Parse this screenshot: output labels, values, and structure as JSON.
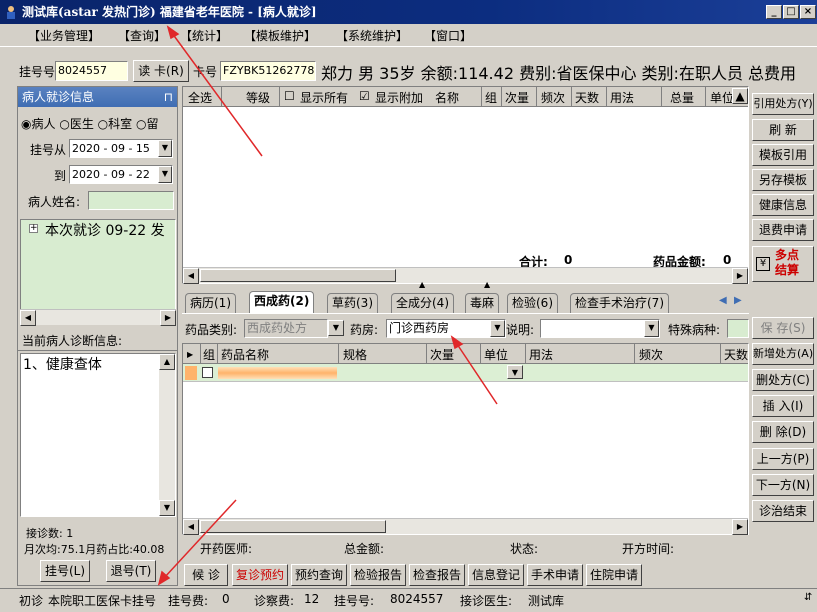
{
  "window": {
    "title": "测试库(astar 发热门诊) 福建省老年医院 - [病人就诊]",
    "min": "_",
    "max": "□",
    "close": "×"
  },
  "menu": [
    "【业务管理】",
    "【查询】",
    "【统计】",
    "【模板维护】",
    "【系统维护】",
    "【窗口】"
  ],
  "info": {
    "reg_label": "挂号号",
    "reg_no": "8024557",
    "read_card": "读 卡(R)",
    "card_label": "卡号",
    "card_no": "FZYBK51262778",
    "patient_line": "郑力  男  35岁  余额:114.42  费别:省医保中心  类别:在职人员  总费用"
  },
  "left": {
    "header": "病人就诊信息",
    "radio_patient": "病人",
    "radio_doctor": "医生",
    "radio_dept": "科室",
    "radio_stay": "留",
    "reg_from_label": "挂号从",
    "date_from": "2020 - 09 - 15",
    "to_label": "到",
    "date_to": "2020 - 09 - 22",
    "name_label": "病人姓名:",
    "tree_item": "本次就诊  09-22 发",
    "diag_header": "当前病人诊断信息:",
    "diag_item": "1、健康查体",
    "visit_count": "接诊数: 1",
    "avg": "月次均:75.1月药占比:40.08",
    "reg_btn": "挂号(L)",
    "unreg_btn": "退号(T)"
  },
  "top_grid": {
    "headers": [
      "全选",
      "等级",
      "显示所有",
      "显示附加",
      "名称",
      "组",
      "次量",
      "频次",
      "天数",
      "用法",
      "总量",
      "单位"
    ],
    "total_label": "合计:",
    "total_val": "0",
    "amount_label": "药品金额:",
    "amount_val": "0"
  },
  "tabs": [
    "病历(1)",
    "西成药(2)",
    "草药(3)",
    "全成分(4)",
    "毒麻",
    "检验(6)",
    "检查手术治疗(7)"
  ],
  "drug_form": {
    "category_label": "药品类别:",
    "category": "西成药处方",
    "pharmacy_label": "药房:",
    "pharmacy": "门诊西药房",
    "note_label": "说明:",
    "note": "",
    "special_label": "特殊病种:"
  },
  "bottom_grid": {
    "headers": [
      "组",
      "药品名称",
      "规格",
      "次量",
      "单位",
      "用法",
      "频次",
      "天数"
    ]
  },
  "presc_footer": {
    "doctor": "开药医师:",
    "total": "总金额:",
    "status": "状态:",
    "time": "开方时间:"
  },
  "bottom_buttons": [
    "候 诊",
    "复诊预约",
    "预约查询",
    "检验报告",
    "检查报告",
    "信息登记",
    "手术申请",
    "住院申请"
  ],
  "right_buttons_top": [
    "引用处方(Y)",
    "刷 新",
    "模板引用",
    "另存模板",
    "健康信息",
    "退费申请"
  ],
  "multi_pay": "多点\n结算",
  "right_buttons_bottom": [
    "保 存(S)",
    "新增处方(A)",
    "删处方(C)",
    "插 入(I)",
    "删 除(D)",
    "上一方(P)",
    "下一方(N)",
    "诊治结束"
  ],
  "status": {
    "type": "初诊",
    "card": "本院职工医保卡挂号",
    "fee_label": "挂号费:",
    "fee": "0",
    "exam_label": "诊察费:",
    "exam": "12",
    "reg_label": "挂号号:",
    "reg": "8024557",
    "doctor_label": "接诊医生:",
    "doctor": "测试库"
  },
  "colors": {
    "title_bar": "#0a246a",
    "panel_header": "#3f6db3",
    "annotation_arrow": "#e0282a",
    "row_highlight": "#ffb36b"
  }
}
